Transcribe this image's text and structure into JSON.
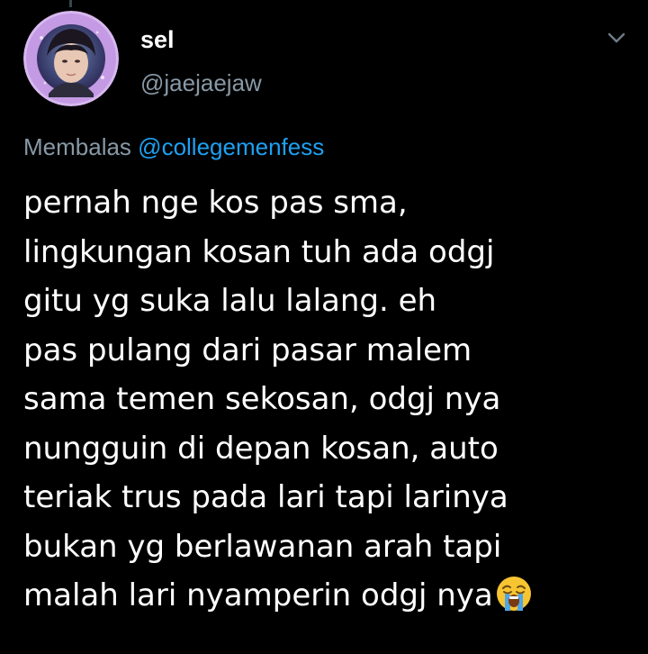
{
  "author": {
    "display_name": "sel",
    "username": "@jaejaejaw",
    "avatar_icon": "profile-photo-with-purple-frame"
  },
  "reply": {
    "prefix": "Membalas",
    "mention": "@collegemenfess"
  },
  "tweet": {
    "lines": [
      "pernah nge kos pas sma,",
      "lingkungan kosan tuh ada odgj",
      "gitu yg suka lalu lalang. eh",
      "pas pulang dari pasar malem",
      "sama temen sekosan, odgj nya",
      "nungguin di depan kosan, auto",
      "teriak trus pada lari tapi larinya",
      "bukan yg berlawanan arah tapi",
      "malah lari nyamperin odgj nya"
    ],
    "trailing_emoji": "loudly-crying-face-icon"
  },
  "icons": {
    "menu": "chevron-down-icon"
  },
  "colors": {
    "background": "#000000",
    "text": "#ffffff",
    "secondary_text": "#8899a6",
    "link": "#1da1f2",
    "avatar_frame": "#c9a2e6"
  }
}
